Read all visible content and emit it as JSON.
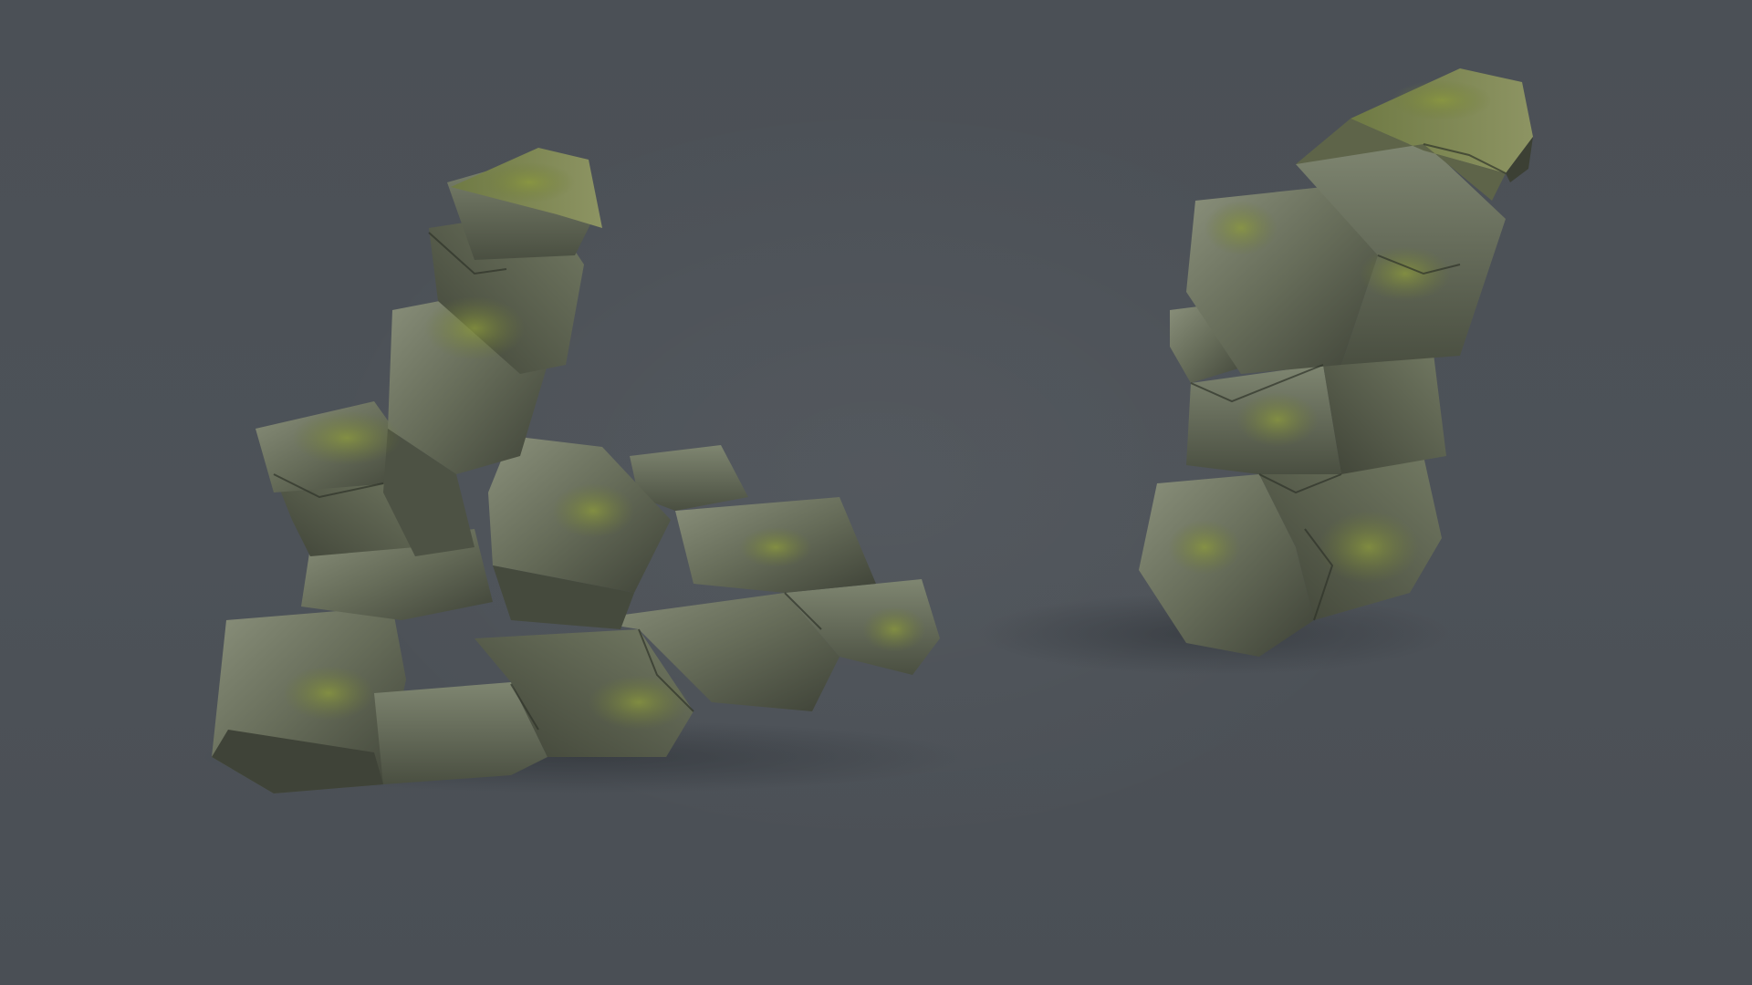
{
  "scene": {
    "background_color": "#4c5157",
    "subjects": [
      {
        "id": "rock-cluster",
        "kind": "stacked-rock-pile",
        "texture": "mossy-stone"
      },
      {
        "id": "rock-pillar",
        "kind": "standing-rock-pillar",
        "texture": "mossy-stone"
      }
    ],
    "palette": {
      "rock_dark": "#3b3f35",
      "rock_mid": "#5d6352",
      "rock_light": "#7e8571",
      "rock_highlight": "#9aa08c",
      "moss": "#6f7a3a",
      "moss_bright": "#8a9440",
      "shadow": "#2d3035"
    }
  }
}
